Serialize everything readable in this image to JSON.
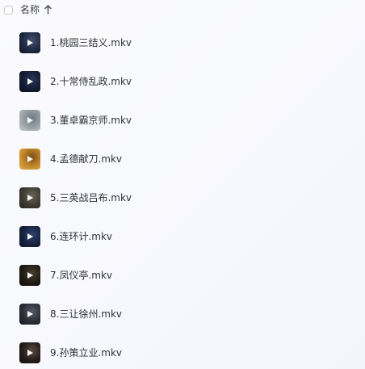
{
  "header": {
    "column_title": "名称",
    "sort_icon": "arrow-up-icon"
  },
  "files": [
    {
      "name": "1.桃园三结义.mkv",
      "thumb_colors": [
        "#1d2a44",
        "#46506a",
        "#0d1220"
      ]
    },
    {
      "name": "2.十常侍乱政.mkv",
      "thumb_colors": [
        "#141c33",
        "#2a3558",
        "#0a0f1d"
      ]
    },
    {
      "name": "3.董卓霸京师.mkv",
      "thumb_colors": [
        "#9aa3a8",
        "#6f7b83",
        "#c9cfd1"
      ]
    },
    {
      "name": "4.孟德献刀.mkv",
      "thumb_colors": [
        "#c48a2c",
        "#7a4d18",
        "#e0b050"
      ]
    },
    {
      "name": "5.三英战吕布.mkv",
      "thumb_colors": [
        "#3c3a32",
        "#6b6656",
        "#24231f"
      ]
    },
    {
      "name": "6.连环计.mkv",
      "thumb_colors": [
        "#17223e",
        "#2f4270",
        "#0b1226"
      ]
    },
    {
      "name": "7.凤仪亭.mkv",
      "thumb_colors": [
        "#1e1a14",
        "#4a3d2a",
        "#0e0c09"
      ]
    },
    {
      "name": "8.三让徐州.mkv",
      "thumb_colors": [
        "#2a2e36",
        "#555b66",
        "#15181d"
      ]
    },
    {
      "name": "9.孙策立业.mkv",
      "thumb_colors": [
        "#241d1a",
        "#5a4a3e",
        "#120d0b"
      ]
    }
  ]
}
